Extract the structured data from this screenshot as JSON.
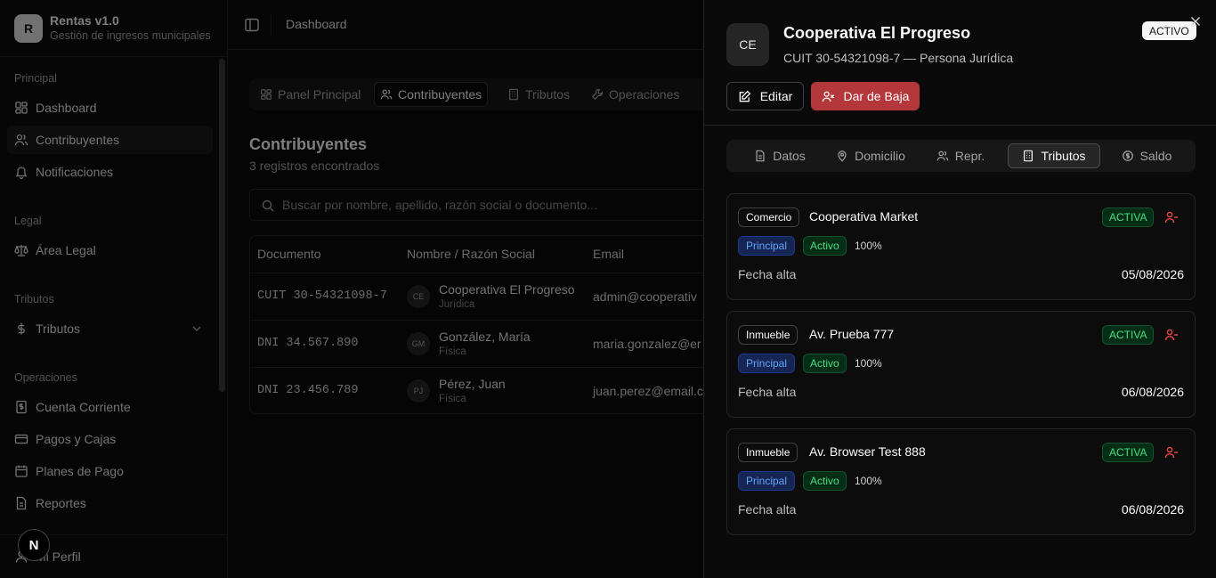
{
  "brand": {
    "logo": "R",
    "title": "Rentas v1.0",
    "subtitle": "Gestión de ingresos municipales"
  },
  "sidebar": {
    "groups": [
      {
        "label": "Principal",
        "items": [
          {
            "label": "Dashboard",
            "icon": "dashboard-icon"
          },
          {
            "label": "Contribuyentes",
            "icon": "users-icon",
            "active": true
          },
          {
            "label": "Notificaciones",
            "icon": "bell-icon"
          }
        ]
      },
      {
        "label": "Legal",
        "items": [
          {
            "label": "Área Legal",
            "icon": "scale-icon"
          }
        ]
      },
      {
        "label": "Tributos",
        "items": [
          {
            "label": "Tributos",
            "icon": "dollar-icon",
            "expandable": true
          }
        ]
      },
      {
        "label": "Operaciones",
        "items": [
          {
            "label": "Cuenta Corriente",
            "icon": "receipt-icon"
          },
          {
            "label": "Pagos y Cajas",
            "icon": "credit-card-icon"
          },
          {
            "label": "Planes de Pago",
            "icon": "calendar-icon"
          },
          {
            "label": "Reportes",
            "icon": "report-icon"
          }
        ]
      }
    ],
    "footer": {
      "profile_label": "Mi Perfil"
    },
    "next_badge": "N"
  },
  "topbar": {
    "breadcrumb": "Dashboard"
  },
  "main": {
    "tabs": [
      {
        "label": "Panel Principal",
        "icon": "grid-icon"
      },
      {
        "label": "Contribuyentes",
        "icon": "users-icon",
        "active": true
      },
      {
        "label": "Tributos",
        "icon": "building-icon"
      },
      {
        "label": "Operaciones",
        "icon": "wrench-icon"
      }
    ],
    "title": "Contribuyentes",
    "subtitle": "3 registros encontrados",
    "search": {
      "placeholder": "Buscar por nombre, apellido, razón social o documento..."
    },
    "table": {
      "headers": [
        "Documento",
        "Nombre / Razón Social",
        "Email"
      ],
      "rows": [
        {
          "documento": "CUIT 30-54321098-7",
          "initials": "CE",
          "nombre": "Cooperativa El Progreso",
          "tipo": "Jurídica",
          "email": "admin@cooperativ"
        },
        {
          "documento": "DNI 34.567.890",
          "initials": "GM",
          "nombre": "González, María",
          "tipo": "Física",
          "email": "maria.gonzalez@er"
        },
        {
          "documento": "DNI 23.456.789",
          "initials": "PJ",
          "nombre": "Pérez, Juan",
          "tipo": "Física",
          "email": "juan.perez@email.c"
        }
      ]
    }
  },
  "drawer": {
    "initials": "CE",
    "name": "Cooperativa El Progreso",
    "subtitle": "CUIT 30-54321098-7 — Persona Jurídica",
    "status": "ACTIVO",
    "edit_label": "Editar",
    "baja_label": "Dar de Baja",
    "tabs": [
      {
        "label": "Datos",
        "icon": "file-icon"
      },
      {
        "label": "Domicilio",
        "icon": "map-pin-icon"
      },
      {
        "label": "Repr.",
        "icon": "users-icon"
      },
      {
        "label": "Tributos",
        "icon": "building-icon",
        "active": true
      },
      {
        "label": "Saldo",
        "icon": "coin-icon"
      }
    ],
    "cards": [
      {
        "type": "Comercio",
        "name": "Cooperativa Market",
        "state": "ACTIVA",
        "role": "Principal",
        "role_state": "Activo",
        "percent": "100%",
        "date_label": "Fecha alta",
        "date": "05/08/2026"
      },
      {
        "type": "Inmueble",
        "name": "Av. Prueba 777",
        "state": "ACTIVA",
        "role": "Principal",
        "role_state": "Activo",
        "percent": "100%",
        "date_label": "Fecha alta",
        "date": "06/08/2026"
      },
      {
        "type": "Inmueble",
        "name": "Av. Browser Test 888",
        "state": "ACTIVA",
        "role": "Principal",
        "role_state": "Activo",
        "percent": "100%",
        "date_label": "Fecha alta",
        "date": "06/08/2026"
      }
    ]
  },
  "colors": {
    "background": "#0a0a0a",
    "danger": "#b4373b",
    "success": "#4ade80",
    "info": "#60a5fa"
  }
}
